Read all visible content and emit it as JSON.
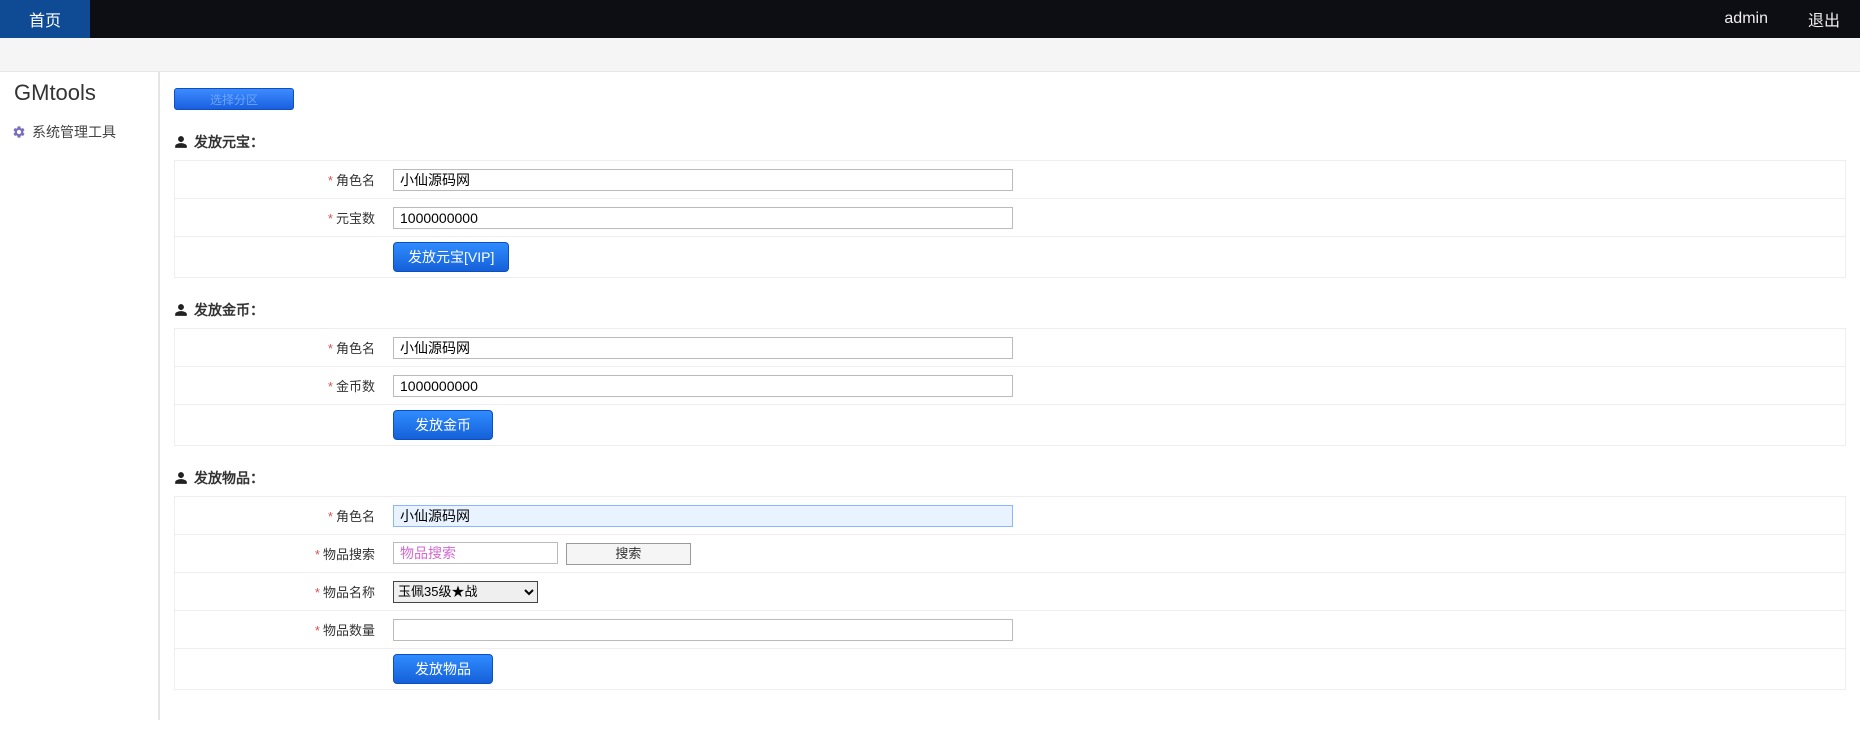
{
  "topbar": {
    "home_tab": "首页",
    "user": "admin",
    "logout": "退出"
  },
  "sidebar": {
    "brand": "GMtools",
    "item1": "系统管理工具"
  },
  "zone_button": "选择分区",
  "sections": {
    "yuanbao": {
      "title": "发放元宝：",
      "role_label": "角色名",
      "role_value": "小仙源码网",
      "amount_label": "元宝数",
      "amount_value": "1000000000",
      "submit": "发放元宝[VIP]"
    },
    "gold": {
      "title": "发放金币：",
      "role_label": "角色名",
      "role_value": "小仙源码网",
      "amount_label": "金币数",
      "amount_value": "1000000000",
      "submit": "发放金币"
    },
    "item": {
      "title": "发放物品：",
      "role_label": "角色名",
      "role_value": "小仙源码网",
      "search_label": "物品搜索",
      "search_placeholder": "物品搜索",
      "search_btn": "搜索",
      "name_label": "物品名称",
      "name_selected": "玉佩35级★战",
      "qty_label": "物品数量",
      "qty_value": "",
      "submit": "发放物品"
    }
  }
}
